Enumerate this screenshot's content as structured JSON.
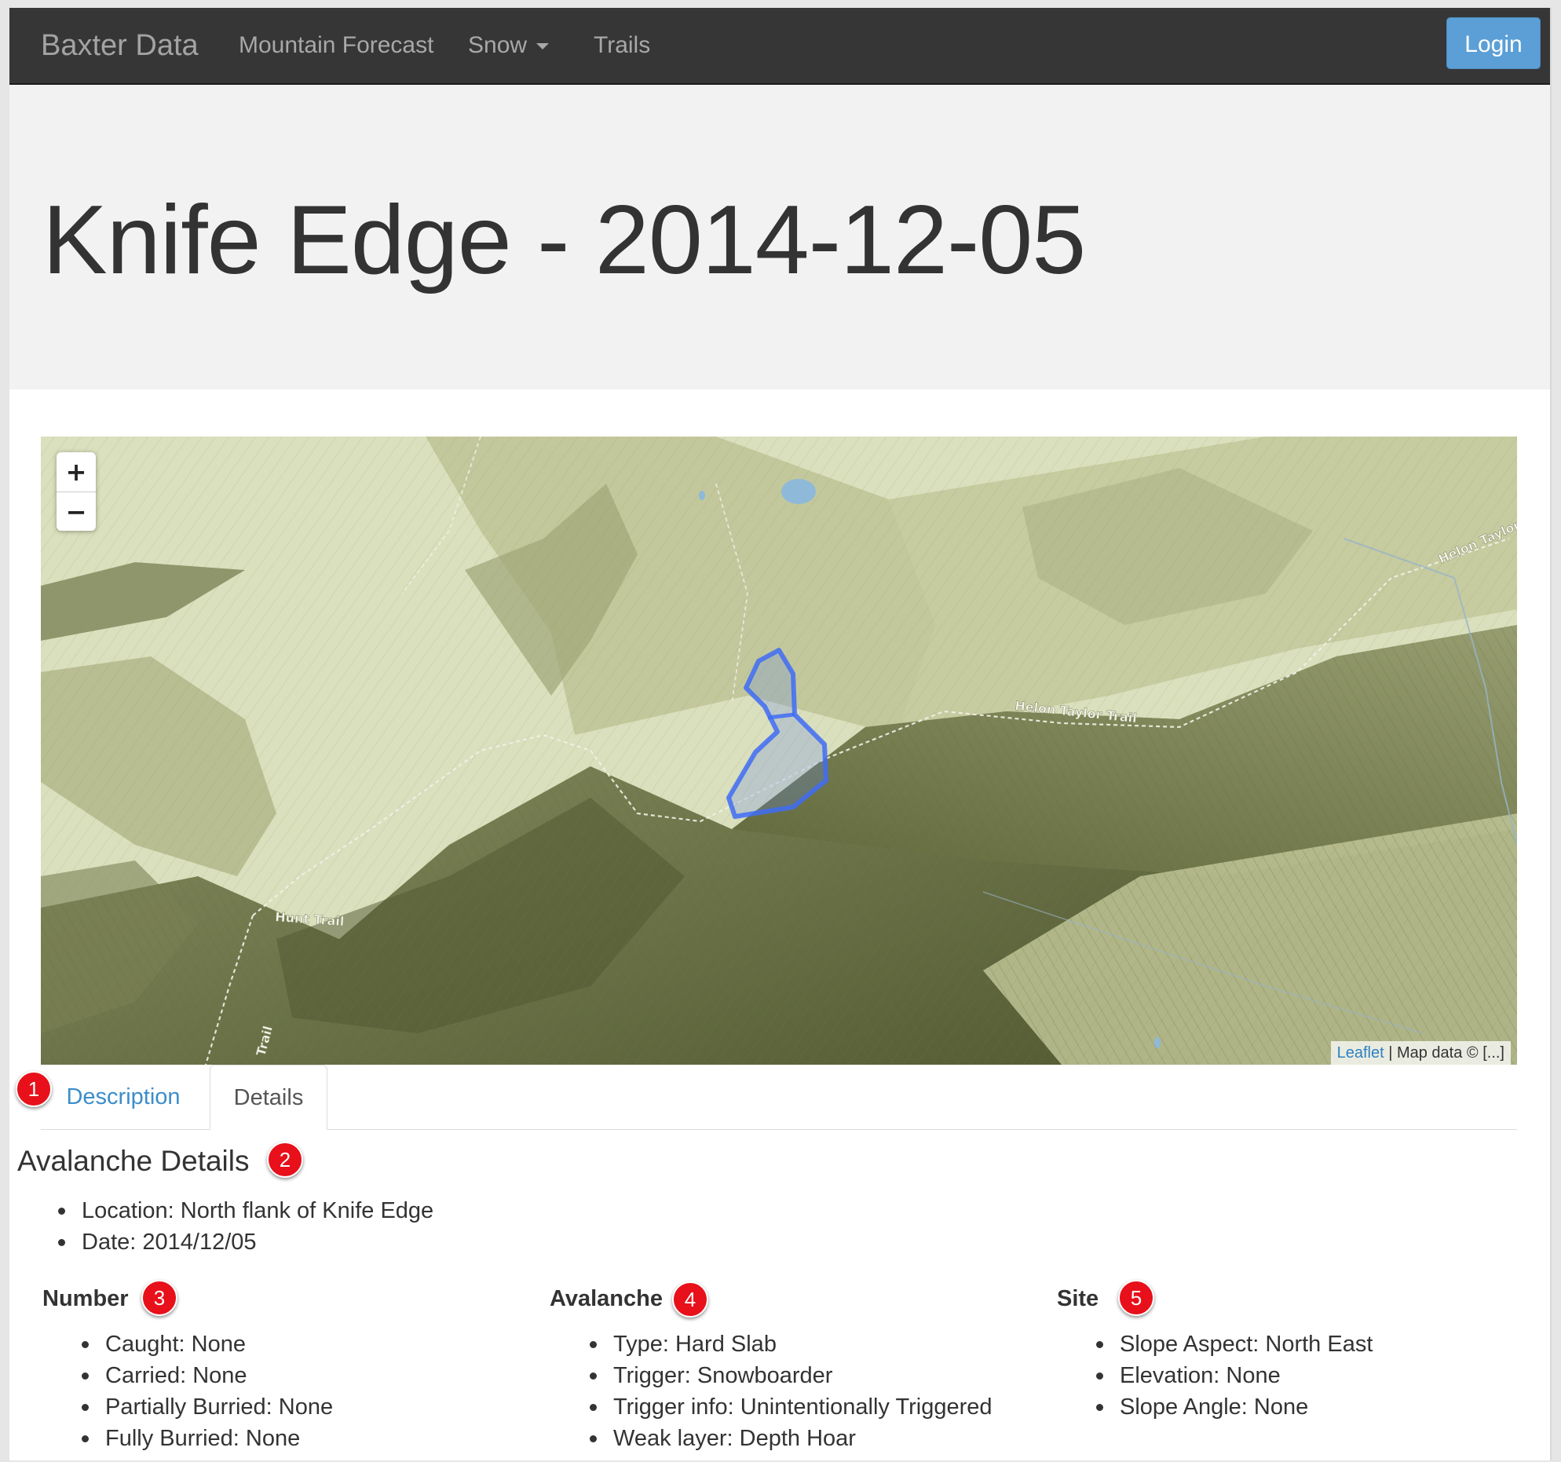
{
  "navbar": {
    "brand": "Baxter Data",
    "links": [
      "Mountain Forecast",
      "Snow",
      "Trails"
    ],
    "login_label": "Login"
  },
  "page_title": "Knife Edge - 2014-12-05",
  "map": {
    "zoom_in": "+",
    "zoom_out": "−",
    "attribution_link": "Leaflet",
    "attribution_text": " | Map data © [...]",
    "trail_labels": [
      "Helon Taylor Trail",
      "Helon Taylor",
      "Hunt Trail",
      "Trail"
    ]
  },
  "tabs": [
    "Description",
    "Details"
  ],
  "details": {
    "title": "Avalanche Details",
    "summary": [
      "Location: North flank of Knife Edge",
      "Date: 2014/12/05"
    ],
    "columns": [
      {
        "title": "Number",
        "items": [
          "Caught: None",
          "Carried: None",
          "Partially Burried: None",
          "Fully Burried: None"
        ]
      },
      {
        "title": "Avalanche",
        "items": [
          "Type: Hard Slab",
          "Trigger: Snowboarder",
          "Trigger info: Unintentionally Triggered",
          "Weak layer: Depth Hoar"
        ]
      },
      {
        "title": "Site",
        "items": [
          "Slope Aspect: North East",
          "Elevation: None",
          "Slope Angle: None"
        ]
      }
    ]
  },
  "markers": [
    "1",
    "2",
    "3",
    "4",
    "5"
  ],
  "colors": {
    "navbar": "#363636",
    "accent": "#5b9fd6",
    "link": "#3c8dca",
    "marker": "#e8101a",
    "avalanche_polygon": "#3f6cf5"
  }
}
